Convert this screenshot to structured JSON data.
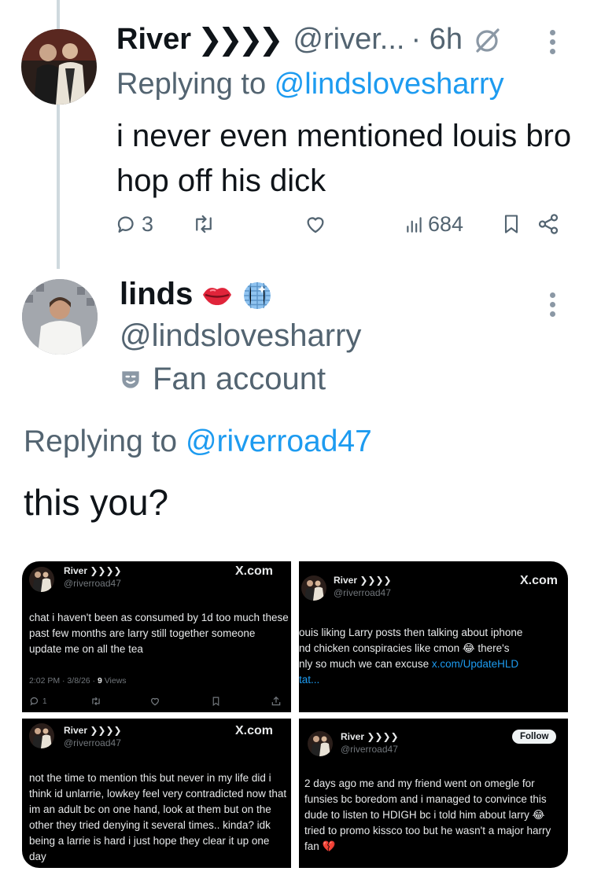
{
  "reply_tweet": {
    "display_name": "River",
    "chevrons": "❯❯❯❯",
    "handle": "@river...",
    "time": "· 6h",
    "replying_prefix": "Replying to ",
    "replying_to": "@lindslovesharry",
    "text": "i never even mentioned louis bro hop off his dick",
    "stats": {
      "replies": "3",
      "views": "684"
    }
  },
  "main_tweet": {
    "display_name": "linds",
    "handle": "@lindslovesharry",
    "badge_label": "Fan account",
    "replying_prefix": "Replying to ",
    "replying_to": "@riverroad47",
    "text": "this you?"
  },
  "media": [
    {
      "name": "River ❯❯❯❯",
      "handle": "@riverroad47",
      "brand": "X.com",
      "text": "chat i haven't been as consumed by 1d too much these past few months are larry still together someone update me on all the tea",
      "meta_time": "2:02 PM · 3/8/26 · ",
      "meta_views_count": "9",
      "meta_views_label": " Views",
      "reply_count": "1"
    },
    {
      "name": "River ❯❯❯❯",
      "handle": "@riverroad47",
      "brand": "X.com",
      "lines": [
        "ouis liking Larry posts then talking about iphone",
        "nd chicken conspiracies like cmon 😂 there's",
        "nly so much we can excuse "
      ],
      "link": "x.com/UpdateHLD",
      "link2": "tat..."
    },
    {
      "name": "River ❯❯❯❯",
      "handle": "@riverroad47",
      "brand": "X.com",
      "text": "not the time to mention this but never in my life did i think id unlarrie, lowkey feel very contradicted now that im an adult bc on one hand, look at them but on the other they tried denying it several times.. kinda? idk being a larrie is hard i just hope they clear it up one day"
    },
    {
      "name": "River ❯❯❯❯",
      "handle": "@riverroad47",
      "follow_label": "Follow",
      "text": "2 days ago me and my friend went on omegle for funsies bc boredom and i managed to convince this dude to listen to HDIGH bc i told him about larry 😂 tried to promo kissco too but he wasn't a major harry fan 💔"
    }
  ],
  "colors": {
    "accent": "#1d9bf0",
    "secondary_text": "#536471",
    "thread_line": "#cfd9de"
  }
}
